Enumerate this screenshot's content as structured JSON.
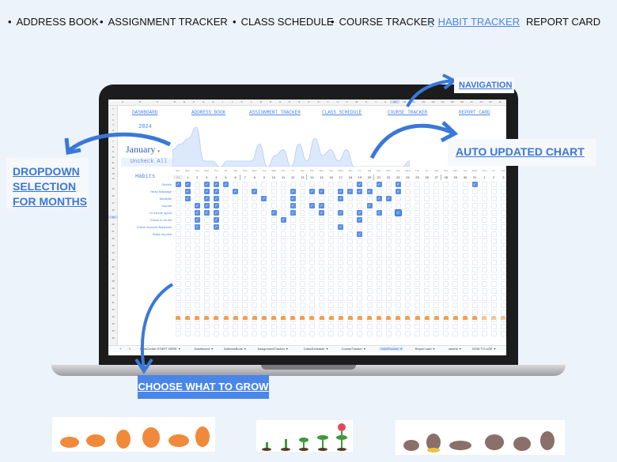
{
  "top_nav": [
    {
      "label": "ADDRESS BOOK"
    },
    {
      "label": "ASSIGNMENT TRACKER"
    },
    {
      "label": "CLASS SCHEDULE"
    },
    {
      "label": "COURSE TRACKER"
    },
    {
      "label": "HABIT TRACKER",
      "active": true
    },
    {
      "label": "REPORT CARD"
    }
  ],
  "callouts": {
    "navigation": "NAVIGATION",
    "chart": "AUTO UPDATED CHART",
    "dropdown": [
      "DROPDOWN",
      "SELECTION",
      "FOR MONTHS"
    ],
    "grow": "CHOOSE WHAT TO GROW"
  },
  "sheet": {
    "links": [
      "DASHBOARD",
      "ADDRESS BOOK",
      "ASSIGNMENT TRACKER",
      "CLASS SCHEDULE",
      "COURSE TRACKER",
      "REPORT CARD"
    ],
    "year": "2024",
    "month": "January",
    "uncheck_label": "Uncheck All",
    "habits_label": "Habits",
    "columns": [
      "A",
      "B",
      "C",
      "D",
      "E",
      "F",
      "G",
      "H",
      "I",
      "J",
      "K",
      "L",
      "M",
      "N",
      "O",
      "P",
      "Q",
      "R",
      "S",
      "T",
      "U",
      "V",
      "W",
      "X",
      "Y",
      "Z",
      "AA",
      "AB",
      "AC",
      "AD",
      "AE",
      "AF",
      "AG",
      "AH",
      "AI",
      "AJ",
      "AK",
      "AL"
    ],
    "weekdays": [
      "Sun",
      "Mon",
      "Tue",
      "Wed",
      "Thu",
      "Fri",
      "Sat"
    ],
    "days": [
      31,
      1,
      2,
      3,
      4,
      5,
      6,
      7,
      8,
      9,
      10,
      11,
      12,
      13,
      14,
      15,
      16,
      17,
      18,
      19,
      20,
      21,
      22,
      23,
      24,
      25,
      26,
      27,
      28,
      29,
      30,
      31,
      1,
      2,
      3
    ],
    "habits": [
      {
        "name": "Stretch",
        "checked": [
          31,
          1,
          3,
          4,
          5,
          19,
          21,
          23
        ],
        "prev31": true
      },
      {
        "name": "Head Massage",
        "checked": [
          1,
          3,
          4,
          6,
          8,
          12,
          14,
          15,
          17,
          18,
          19,
          20,
          23
        ]
      },
      {
        "name": "Meditate",
        "checked": [
          1,
          3,
          4,
          9,
          12,
          17,
          21,
          22
        ]
      },
      {
        "name": "Journal",
        "checked": [
          2,
          3,
          4,
          12,
          14,
          15,
          20
        ]
      },
      {
        "name": "10 minute sprint",
        "checked": [
          2,
          3,
          4,
          10,
          12,
          15,
          17,
          19,
          21,
          23
        ]
      },
      {
        "name": "Check to do list",
        "checked": [
          2,
          4,
          11,
          19
        ]
      },
      {
        "name": "Check Account Balances",
        "checked": [
          2,
          4,
          17
        ]
      },
      {
        "name": "Make my bed",
        "checked": [
          19
        ]
      }
    ],
    "tabs": [
      "DataCenter-START HERE",
      "Dashboard",
      "AddressBook",
      "AssignmentTracker",
      "ClassSchedule",
      "CourseTracker",
      "HabitTracker",
      "Report card",
      "assets",
      "HOW TO USE"
    ],
    "active_tab": "HabitTracker"
  },
  "colors": {
    "accent": "#4a86e8",
    "background": "#edf3fb",
    "plant": "#f0a050"
  }
}
